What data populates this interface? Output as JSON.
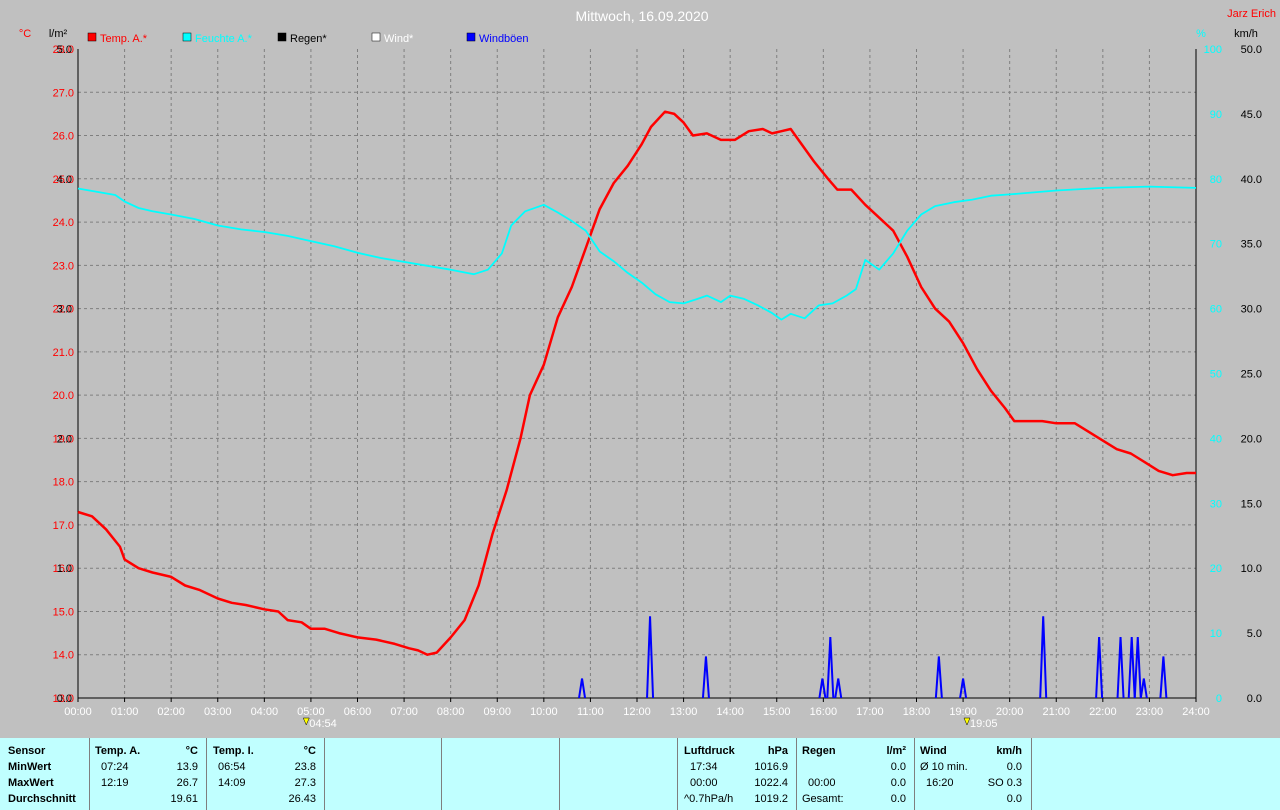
{
  "header": {
    "title": "Mittwoch, 16.09.2020",
    "author": "Jarz Erich"
  },
  "axes": {
    "left1_unit": "°C",
    "left2_unit": "l/m²",
    "right1_unit": "%",
    "right2_unit": "km/h",
    "temp_ticks": [
      "28.0",
      "27.0",
      "26.0",
      "25.0",
      "24.0",
      "23.0",
      "22.0",
      "21.0",
      "20.0",
      "19.0",
      "18.0",
      "17.0",
      "16.0",
      "15.0",
      "14.0",
      "13.0"
    ],
    "rain_ticks": [
      "5.0",
      "4.0",
      "3.0",
      "2.0",
      "1.0",
      "0.0"
    ],
    "hum_ticks": [
      "100",
      "90",
      "80",
      "70",
      "60",
      "50",
      "40",
      "30",
      "20",
      "10",
      "0"
    ],
    "wind_ticks": [
      "50.0",
      "45.0",
      "40.0",
      "35.0",
      "30.0",
      "25.0",
      "20.0",
      "15.0",
      "10.0",
      "5.0",
      "0.0"
    ],
    "time_ticks": [
      "00:00",
      "01:00",
      "02:00",
      "03:00",
      "04:00",
      "05:00",
      "06:00",
      "07:00",
      "08:00",
      "09:00",
      "10:00",
      "11:00",
      "12:00",
      "13:00",
      "14:00",
      "15:00",
      "16:00",
      "17:00",
      "18:00",
      "19:00",
      "20:00",
      "21:00",
      "22:00",
      "23:00",
      "24:00"
    ],
    "sunrise": "04:54",
    "sunset": "19:05"
  },
  "legend": [
    {
      "label": "Temp. A.*",
      "color": "#ff0000"
    },
    {
      "label": "Feuchte A.*",
      "color": "#00ffff"
    },
    {
      "label": "Regen*",
      "color": "#000000"
    },
    {
      "label": "Wind*",
      "color": "#ffffff"
    },
    {
      "label": "Windböen",
      "color": "#0000ff"
    }
  ],
  "chart_data": {
    "type": "line",
    "title": "Mittwoch, 16.09.2020",
    "x_unit": "hour of day",
    "xlim": [
      0,
      24
    ],
    "temp_ylim": [
      13,
      28
    ],
    "rain_ylim": [
      0,
      5
    ],
    "hum_ylim": [
      0,
      100
    ],
    "wind_ylim": [
      0,
      50
    ],
    "grid": true,
    "series": [
      {
        "name": "Temp. A.*",
        "axis": "temp",
        "color": "#ff0000",
        "points": [
          [
            0,
            17.3
          ],
          [
            0.3,
            17.2
          ],
          [
            0.6,
            16.9
          ],
          [
            0.9,
            16.5
          ],
          [
            1.0,
            16.2
          ],
          [
            1.3,
            16.0
          ],
          [
            1.6,
            15.9
          ],
          [
            2.0,
            15.8
          ],
          [
            2.3,
            15.6
          ],
          [
            2.6,
            15.5
          ],
          [
            3.0,
            15.3
          ],
          [
            3.3,
            15.2
          ],
          [
            3.6,
            15.15
          ],
          [
            4.0,
            15.05
          ],
          [
            4.3,
            15.0
          ],
          [
            4.5,
            14.8
          ],
          [
            4.8,
            14.75
          ],
          [
            5.0,
            14.6
          ],
          [
            5.3,
            14.6
          ],
          [
            5.6,
            14.5
          ],
          [
            6.0,
            14.4
          ],
          [
            6.4,
            14.35
          ],
          [
            6.8,
            14.25
          ],
          [
            7.1,
            14.15
          ],
          [
            7.3,
            14.1
          ],
          [
            7.5,
            14.0
          ],
          [
            7.7,
            14.05
          ],
          [
            8.0,
            14.4
          ],
          [
            8.3,
            14.8
          ],
          [
            8.6,
            15.6
          ],
          [
            8.9,
            16.8
          ],
          [
            9.2,
            17.8
          ],
          [
            9.5,
            19.0
          ],
          [
            9.7,
            20.0
          ],
          [
            10.0,
            20.7
          ],
          [
            10.3,
            21.8
          ],
          [
            10.6,
            22.5
          ],
          [
            10.9,
            23.4
          ],
          [
            11.2,
            24.3
          ],
          [
            11.5,
            24.9
          ],
          [
            11.8,
            25.3
          ],
          [
            12.1,
            25.8
          ],
          [
            12.3,
            26.2
          ],
          [
            12.6,
            26.55
          ],
          [
            12.8,
            26.5
          ],
          [
            13.0,
            26.3
          ],
          [
            13.2,
            26.0
          ],
          [
            13.5,
            26.05
          ],
          [
            13.8,
            25.9
          ],
          [
            14.1,
            25.9
          ],
          [
            14.4,
            26.1
          ],
          [
            14.7,
            26.15
          ],
          [
            14.9,
            26.05
          ],
          [
            15.1,
            26.1
          ],
          [
            15.3,
            26.15
          ],
          [
            15.5,
            25.85
          ],
          [
            15.8,
            25.4
          ],
          [
            16.1,
            25.0
          ],
          [
            16.3,
            24.75
          ],
          [
            16.6,
            24.75
          ],
          [
            16.9,
            24.4
          ],
          [
            17.2,
            24.1
          ],
          [
            17.5,
            23.8
          ],
          [
            17.8,
            23.2
          ],
          [
            18.1,
            22.5
          ],
          [
            18.4,
            22.0
          ],
          [
            18.7,
            21.7
          ],
          [
            19.0,
            21.2
          ],
          [
            19.3,
            20.6
          ],
          [
            19.6,
            20.1
          ],
          [
            19.9,
            19.7
          ],
          [
            20.1,
            19.4
          ],
          [
            20.4,
            19.4
          ],
          [
            20.7,
            19.4
          ],
          [
            21.0,
            19.35
          ],
          [
            21.4,
            19.35
          ],
          [
            21.7,
            19.15
          ],
          [
            22.0,
            18.95
          ],
          [
            22.3,
            18.75
          ],
          [
            22.6,
            18.65
          ],
          [
            22.9,
            18.45
          ],
          [
            23.2,
            18.25
          ],
          [
            23.5,
            18.15
          ],
          [
            23.8,
            18.2
          ],
          [
            24.0,
            18.2
          ]
        ]
      },
      {
        "name": "Feuchte A.*",
        "axis": "hum",
        "color": "#00ffff",
        "points": [
          [
            0,
            78.5
          ],
          [
            0.4,
            78
          ],
          [
            0.8,
            77.5
          ],
          [
            1.0,
            76.5
          ],
          [
            1.3,
            75.5
          ],
          [
            1.6,
            75
          ],
          [
            2.0,
            74.5
          ],
          [
            2.5,
            73.8
          ],
          [
            3.0,
            72.8
          ],
          [
            3.5,
            72.2
          ],
          [
            4.0,
            71.8
          ],
          [
            4.5,
            71.2
          ],
          [
            5.0,
            70.4
          ],
          [
            5.5,
            69.6
          ],
          [
            6.0,
            68.6
          ],
          [
            6.5,
            67.8
          ],
          [
            7.0,
            67.2
          ],
          [
            7.5,
            66.6
          ],
          [
            8.0,
            66.0
          ],
          [
            8.5,
            65.3
          ],
          [
            8.8,
            66.0
          ],
          [
            9.1,
            68.5
          ],
          [
            9.3,
            72.8
          ],
          [
            9.6,
            75.0
          ],
          [
            10.0,
            76.0
          ],
          [
            10.3,
            74.8
          ],
          [
            10.6,
            73.5
          ],
          [
            10.9,
            72.0
          ],
          [
            11.2,
            68.8
          ],
          [
            11.5,
            67.3
          ],
          [
            11.8,
            65.5
          ],
          [
            12.1,
            64.0
          ],
          [
            12.4,
            62.2
          ],
          [
            12.7,
            61.0
          ],
          [
            13.0,
            60.8
          ],
          [
            13.3,
            61.5
          ],
          [
            13.5,
            62.0
          ],
          [
            13.8,
            61.0
          ],
          [
            14.0,
            62.0
          ],
          [
            14.3,
            61.5
          ],
          [
            14.6,
            60.5
          ],
          [
            14.9,
            59.3
          ],
          [
            15.1,
            58.3
          ],
          [
            15.3,
            59.2
          ],
          [
            15.6,
            58.5
          ],
          [
            15.9,
            60.5
          ],
          [
            16.2,
            60.8
          ],
          [
            16.5,
            62.0
          ],
          [
            16.7,
            63.0
          ],
          [
            16.9,
            67.5
          ],
          [
            17.2,
            66.0
          ],
          [
            17.5,
            68.5
          ],
          [
            17.8,
            72.0
          ],
          [
            18.1,
            74.5
          ],
          [
            18.4,
            75.8
          ],
          [
            18.8,
            76.4
          ],
          [
            19.2,
            76.8
          ],
          [
            19.6,
            77.4
          ],
          [
            20.0,
            77.6
          ],
          [
            21.0,
            78.2
          ],
          [
            22.0,
            78.6
          ],
          [
            23.0,
            78.8
          ],
          [
            24.0,
            78.6
          ]
        ]
      },
      {
        "name": "Windböen",
        "axis": "wind",
        "color": "#0000ff",
        "spikes": [
          [
            10.82,
            1.5
          ],
          [
            12.28,
            6.3
          ],
          [
            13.48,
            3.2
          ],
          [
            15.98,
            1.5
          ],
          [
            16.15,
            4.7
          ],
          [
            16.32,
            1.5
          ],
          [
            18.48,
            3.2
          ],
          [
            19.0,
            1.5
          ],
          [
            20.72,
            6.3
          ],
          [
            21.92,
            4.7
          ],
          [
            22.38,
            4.7
          ],
          [
            22.62,
            4.7
          ],
          [
            22.75,
            4.7
          ],
          [
            22.88,
            1.5
          ],
          [
            23.3,
            3.2
          ]
        ]
      }
    ]
  },
  "footer": {
    "sensor_header": "Sensor",
    "minwert": "MinWert",
    "maxwert": "MaxWert",
    "durchschnitt": "Durchschnitt",
    "temp_a_header": "Temp. A.",
    "temp_a_unit": "°C",
    "temp_a_min_time": "07:24",
    "temp_a_min": "13.9",
    "temp_a_max_time": "12:19",
    "temp_a_max": "26.7",
    "temp_a_avg": "19.61",
    "temp_i_header": "Temp. I.",
    "temp_i_unit": "°C",
    "temp_i_min_time": "06:54",
    "temp_i_min": "23.8",
    "temp_i_max_time": "14:09",
    "temp_i_max": "27.3",
    "temp_i_avg": "26.43",
    "luft_header": "Luftdruck",
    "luft_unit": "hPa",
    "luft_min_time": "17:34",
    "luft_min": "1016.9",
    "luft_max_time": "00:00",
    "luft_max": "1022.4",
    "luft_trend": "^0.7hPa/h",
    "luft_avg": "1019.2",
    "regen_header": "Regen",
    "regen_unit": "l/m²",
    "regen_max_time": "00:00",
    "regen_max": "0.0",
    "regen_gesamt_label": "Gesamt:",
    "regen_gesamt": "0.0",
    "regen_min": "0.0",
    "wind_header": "Wind",
    "wind_unit": "km/h",
    "wind_avg_label": "Ø 10 min.",
    "wind_avg": "0.0",
    "wind_max_time": "16:20",
    "wind_max": "SO 0.3",
    "wind_day_avg": "0.0"
  }
}
